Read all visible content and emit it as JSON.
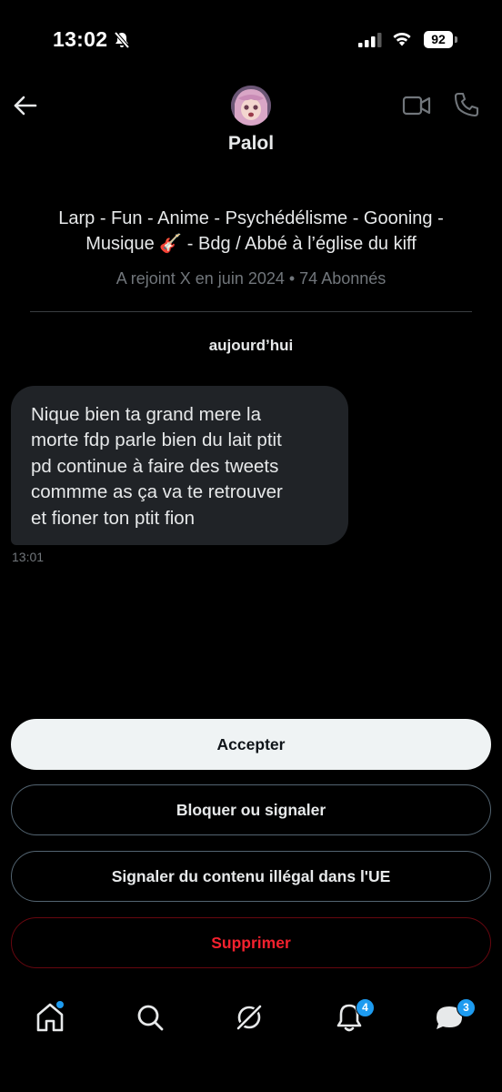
{
  "status_bar": {
    "time": "13:02",
    "battery": "92",
    "icons": [
      "bell-slash-icon",
      "cellular-signal-icon",
      "wifi-icon",
      "battery-icon"
    ]
  },
  "header": {
    "back_icon": "arrow-left-icon",
    "name": "Palol",
    "video_icon": "video-camera-icon",
    "phone_icon": "phone-icon"
  },
  "profile": {
    "bio": "Larp - Fun - Anime - Psychédélisme - Gooning - Musique 🎸 - Bdg / Abbé à l’église du kiff",
    "joined": "A rejoint X en juin 2024 • 74 Abonnés"
  },
  "conversation": {
    "day_label": "aujourd’hui",
    "messages": [
      {
        "text": "Nique bien ta grand mere la\nmorte fdp parle bien du lait ptit\npd continue à faire des tweets\ncommme as ça va te retrouver\net fioner ton ptit fion",
        "time": "13:01"
      }
    ]
  },
  "actions": {
    "accept": "Accepter",
    "block_report": "Bloquer ou signaler",
    "report_illegal": "Signaler du contenu illégal dans l'UE",
    "delete": "Supprimer"
  },
  "bottom_nav": {
    "home_icon": "home-icon",
    "search_icon": "search-icon",
    "grok_icon": "grok-icon",
    "notifications_icon": "bell-icon",
    "notifications_badge": "4",
    "messages_icon": "messages-icon",
    "messages_badge": "3"
  },
  "colors": {
    "background": "#000000",
    "accent": "#1d9bf0",
    "danger": "#f4212e",
    "bubble": "#202327",
    "muted": "#71767b"
  }
}
